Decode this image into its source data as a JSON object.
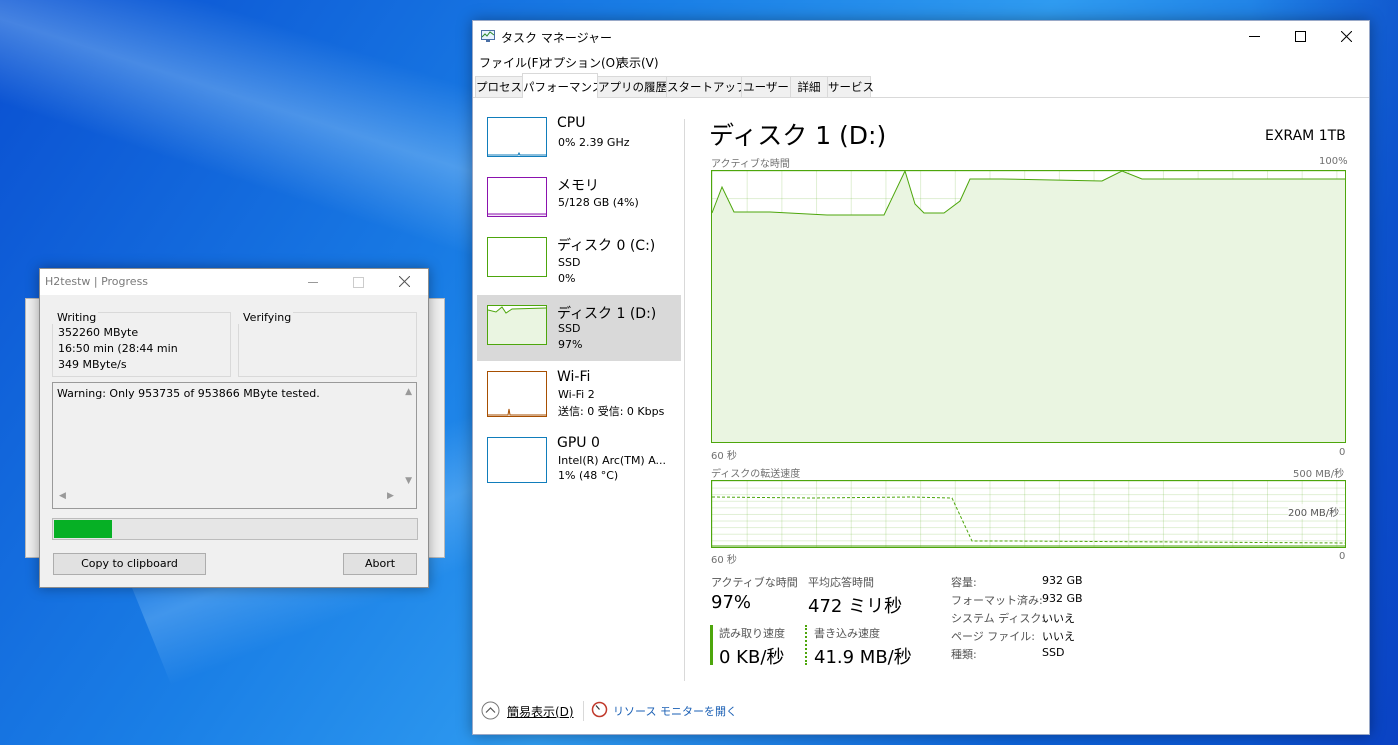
{
  "taskmgr": {
    "title": "タスク マネージャー",
    "menu": [
      "ファイル(F)",
      "オプション(O)",
      "表示(V)"
    ],
    "tabs": [
      "プロセス",
      "パフォーマンス",
      "アプリの履歴",
      "スタートアップ",
      "ユーザー",
      "詳細",
      "サービス"
    ],
    "active_tab": "パフォーマンス",
    "sidebar": [
      {
        "title": "CPU",
        "sub1": "0%  2.39 GHz",
        "sub2": "",
        "color": "#117dbb"
      },
      {
        "title": "メモリ",
        "sub1": "5/128 GB (4%)",
        "sub2": "",
        "color": "#8b12ae"
      },
      {
        "title": "ディスク 0 (C:)",
        "sub1": "SSD",
        "sub2": "0%",
        "color": "#4da60c"
      },
      {
        "title": "ディスク 1 (D:)",
        "sub1": "SSD",
        "sub2": "97%",
        "color": "#4da60c"
      },
      {
        "title": "Wi-Fi",
        "sub1": "Wi-Fi 2",
        "sub2": "送信: 0 受信: 0 Kbps",
        "color": "#a74f01"
      },
      {
        "title": "GPU 0",
        "sub1": "Intel(R) Arc(TM) A...",
        "sub2": "1% (48 °C)",
        "color": "#117dbb"
      }
    ],
    "main": {
      "title": "ディスク 1 (D:)",
      "model": "EXRAM 1TB",
      "graph1_label": "アクティブな時間",
      "graph1_max": "100%",
      "graph1_x_left": "60 秒",
      "graph1_x_right": "0",
      "graph2_label": "ディスクの転送速度",
      "graph2_max": "500 MB/秒",
      "graph2_mid": "200 MB/秒",
      "graph2_x_left": "60 秒",
      "graph2_x_right": "0"
    },
    "stats": {
      "active_label": "アクティブな時間",
      "active_value": "97%",
      "resp_label": "平均応答時間",
      "resp_value": "472 ミリ秒",
      "read_label": "読み取り速度",
      "read_value": "0 KB/秒",
      "write_label": "書き込み速度",
      "write_value": "41.9 MB/秒"
    },
    "info": [
      {
        "k": "容量:",
        "v": "932 GB"
      },
      {
        "k": "フォーマット済み:",
        "v": "932 GB"
      },
      {
        "k": "システム ディスク:",
        "v": "いいえ"
      },
      {
        "k": "ページ ファイル:",
        "v": "いいえ"
      },
      {
        "k": "種類:",
        "v": "SSD"
      }
    ],
    "footer": {
      "fewer_details": "簡易表示(D)",
      "resource_monitor": "リソース モニターを開く"
    },
    "accent": "#4da60c"
  },
  "h2testw": {
    "title": "H2testw | Progress",
    "writing_label": "Writing",
    "verifying_label": "Verifying",
    "writing_lines": [
      "352260 MByte",
      "16:50 min (28:44 min",
      "349 MByte/s"
    ],
    "warning": "Warning: Only 953735 of 953866 MByte tested.",
    "progress": 0.16,
    "copy_button": "Copy to clipboard",
    "abort_button": "Abort",
    "progress_color": "#06b025"
  }
}
